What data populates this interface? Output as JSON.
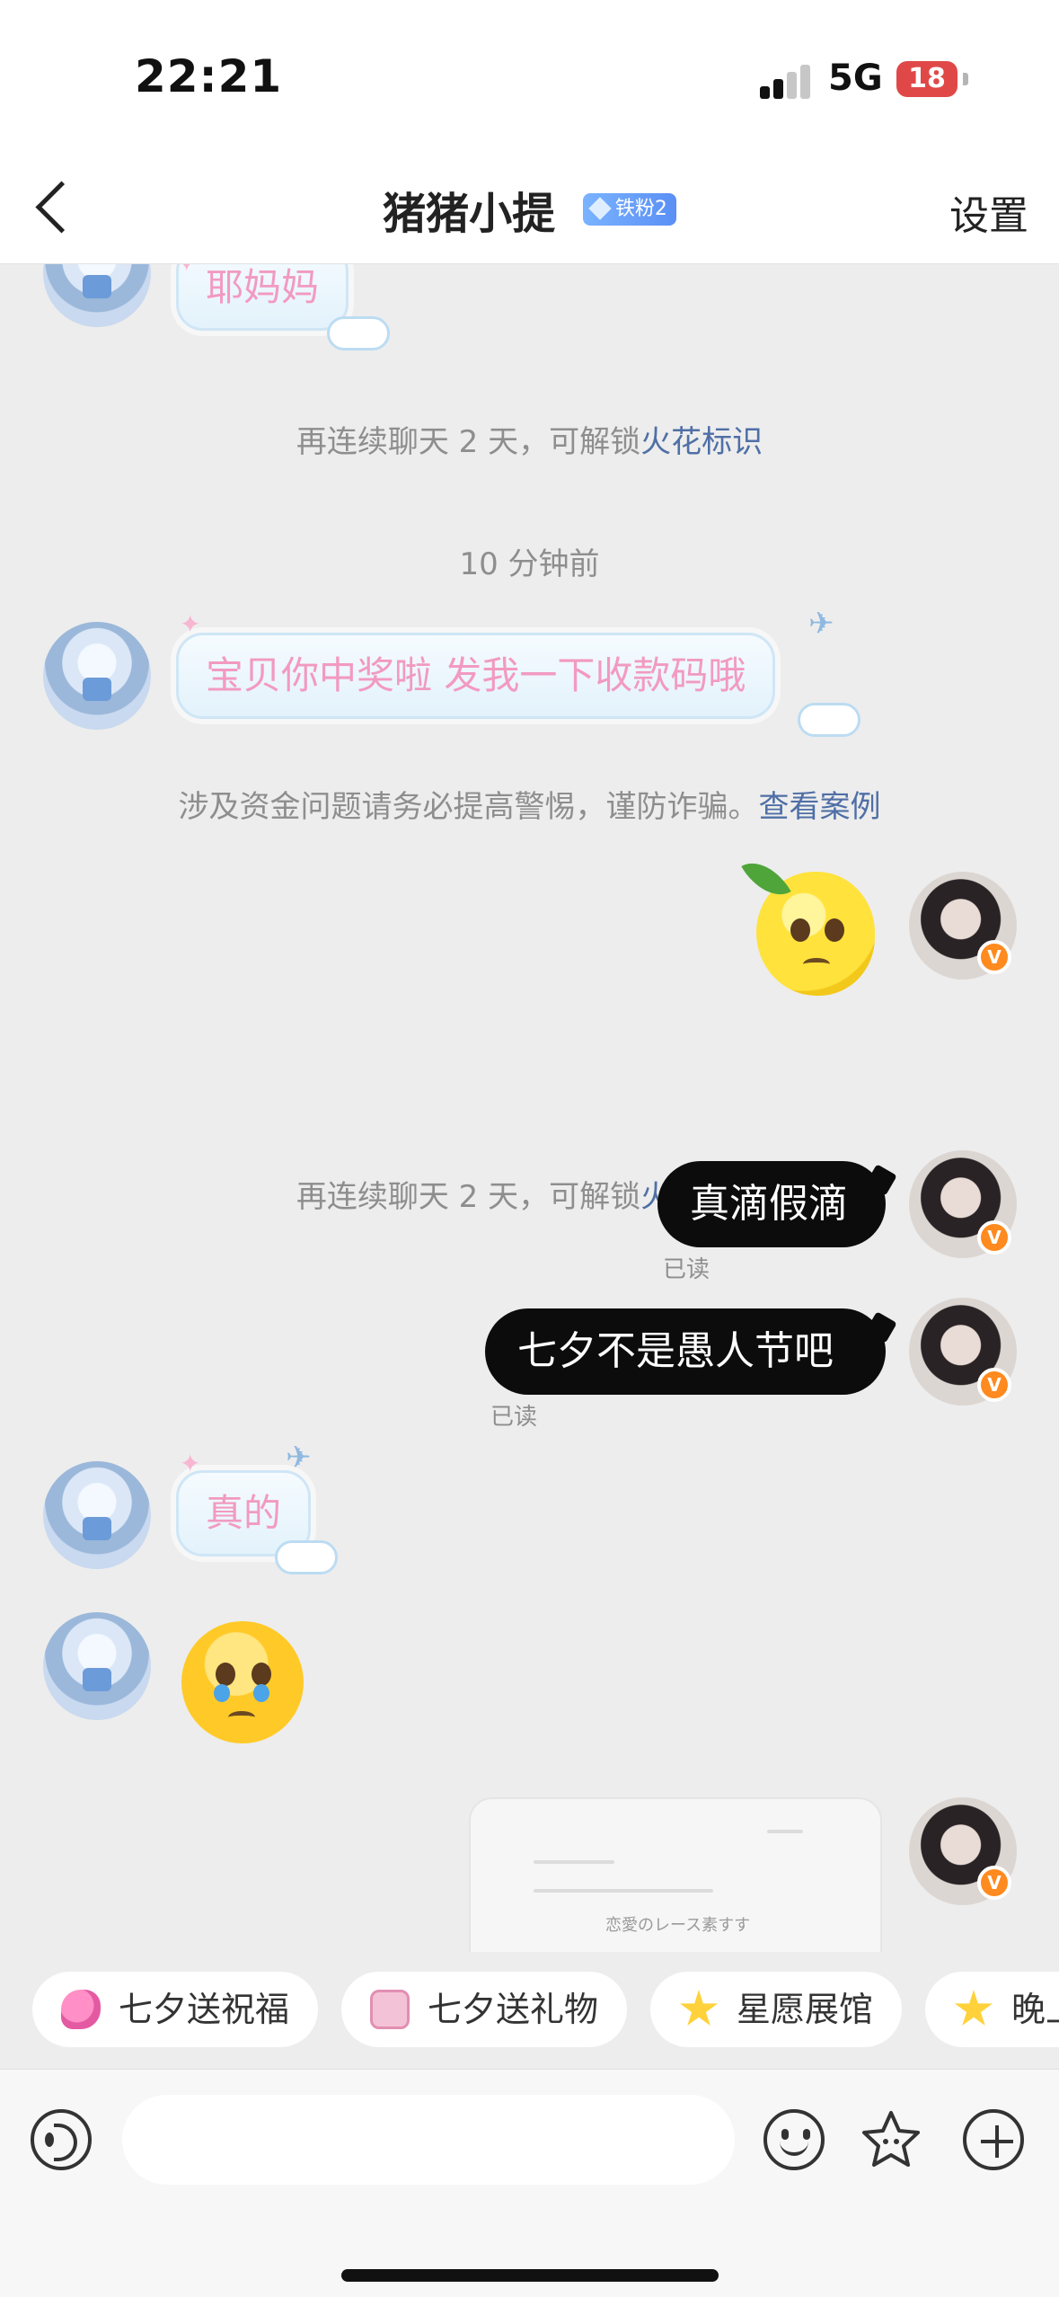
{
  "status": {
    "time": "22:21",
    "network": "5G",
    "battery": "18"
  },
  "nav": {
    "title": "猪猪小提",
    "fan_badge": "铁粉2",
    "settings": "设置"
  },
  "messages": {
    "m1": "耶妈妈",
    "sys1_text": "再连续聊天 2 天，可解锁",
    "sys1_link": "火花标识",
    "time_divider": "10 分钟前",
    "m2": "宝贝你中奖啦 发我一下收款码哦",
    "warning_text": "涉及资金问题请务必提高警惕，谨防诈骗。",
    "warning_link": "查看案例",
    "sys2_text": "再连续聊天 2 天，可解锁",
    "sys2_link": "火花标识",
    "m3": "真滴假滴",
    "m3_status": "已读",
    "m4": "七夕不是愚人节吧",
    "m4_status": "已读",
    "m5": "真的",
    "card_title": "恋愛のレース素すす"
  },
  "chips": [
    "七夕送祝福",
    "七夕送礼物",
    "星愿展馆",
    "晚上"
  ],
  "input": {
    "placeholder": ""
  },
  "colors": {
    "accent_link": "#4f6fa6",
    "bubble_text_pink": "#f29ac1",
    "badge_orange": "#ff8a1f",
    "battery_red": "#e04848"
  }
}
